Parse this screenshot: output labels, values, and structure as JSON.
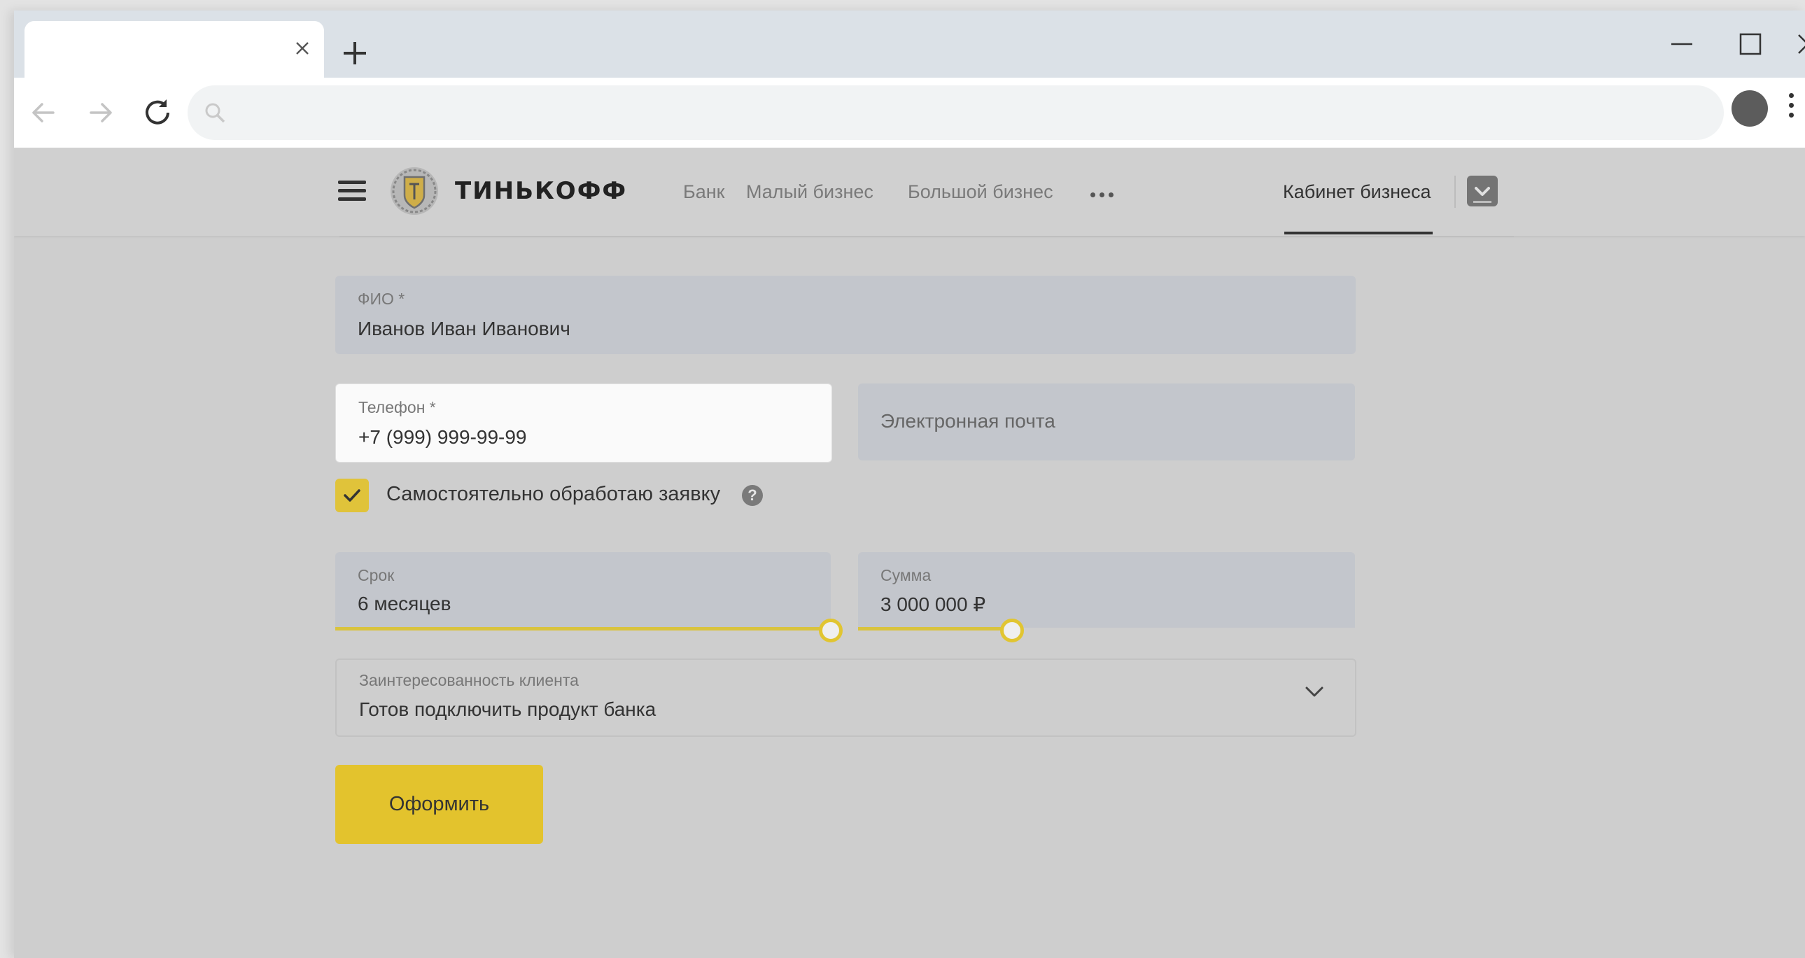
{
  "browser": {
    "tab_title": "",
    "address": "",
    "icons": [
      "close-icon",
      "plus-icon",
      "minimize-icon",
      "maximize-icon",
      "back-arrow-icon",
      "forward-arrow-icon",
      "reload-icon",
      "search-icon",
      "star-icon",
      "profile-icon",
      "menu-dots-icon"
    ]
  },
  "header": {
    "logo_text": "ТИНЬКОФФ",
    "nav": [
      "Банк",
      "Малый бизнес",
      "Большой бизнес"
    ],
    "cabinet": "Кабинет бизнеса"
  },
  "form": {
    "fio_label": "ФИО *",
    "fio_value": "Иванов Иван Иванович",
    "phone_label": "Телефон *",
    "phone_value": "+7 (999) 999-99-99",
    "email_placeholder": "Электронная почта",
    "self_process_label": "Самостоятельно обработаю заявку",
    "self_process_checked": true,
    "term_label": "Срок",
    "term_value": "6 месяцев",
    "term_slider_fraction": 1.0,
    "amount_label": "Сумма",
    "amount_value": "3 000 000 ₽",
    "amount_slider_fraction": 0.31,
    "interest_label": "Заинтересованность клиента",
    "interest_value": "Готов подключить продукт банка",
    "submit_label": "Оформить"
  },
  "colors": {
    "accent": "#e3c32d",
    "page_bg": "#cecece"
  }
}
